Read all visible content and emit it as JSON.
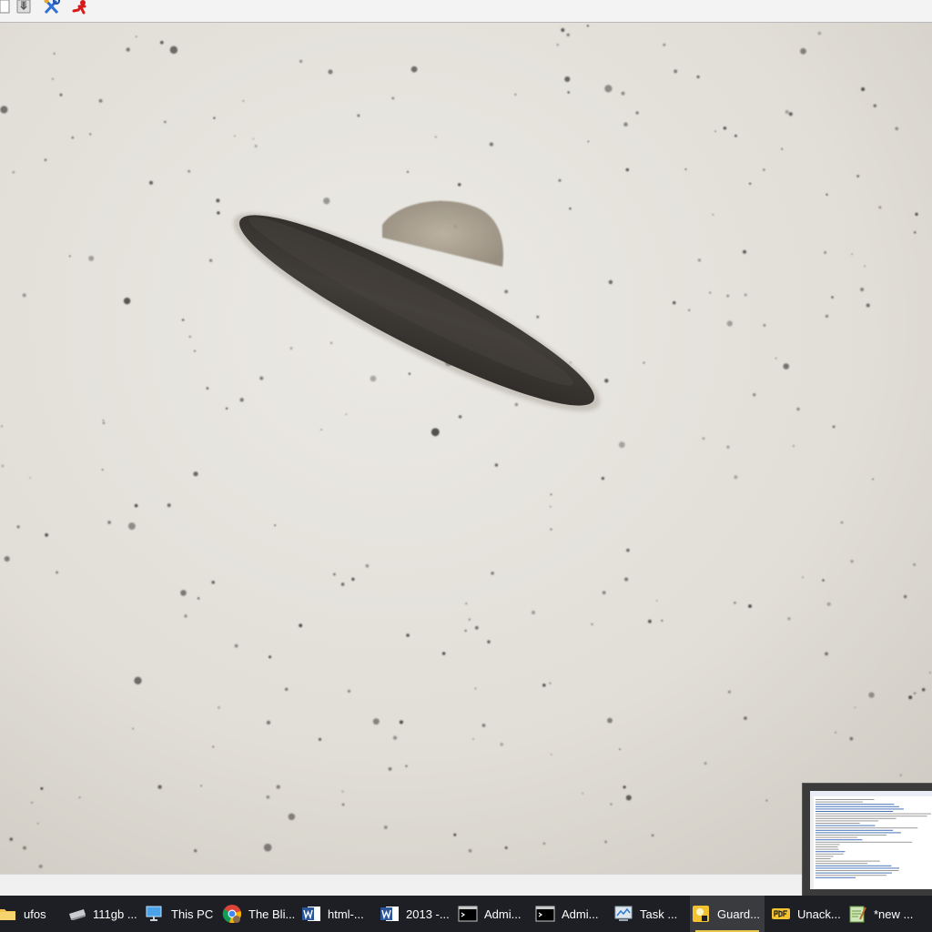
{
  "toolbar": {
    "buttons": [
      {
        "icon": "page-icon"
      },
      {
        "icon": "save-icon"
      },
      {
        "icon": "tools-icon"
      },
      {
        "icon": "exit-icon"
      }
    ]
  },
  "viewer": {
    "image": "flying-saucer-photo",
    "colors": {
      "background": "#e6e4df",
      "saucer": "#3a3734"
    }
  },
  "taskbar": {
    "items": [
      {
        "label": "ufos",
        "icon": "folder-icon"
      },
      {
        "label": "111gb ...",
        "icon": "drive-icon"
      },
      {
        "label": "This PC",
        "icon": "computer-icon"
      },
      {
        "label": "The Bli...",
        "icon": "chrome-icon"
      },
      {
        "label": "html-...",
        "icon": "word-icon"
      },
      {
        "label": "2013 -...",
        "icon": "word-icon"
      },
      {
        "label": "Admi...",
        "icon": "cmd-icon"
      },
      {
        "label": "Admi...",
        "icon": "cmd-icon"
      },
      {
        "label": "Task ...",
        "icon": "task-manager-icon"
      },
      {
        "label": "Guard...",
        "icon": "guard-icon"
      },
      {
        "label": "Unack...",
        "icon": "pdf-icon"
      },
      {
        "label": "*new ...",
        "icon": "notepad-icon"
      }
    ]
  }
}
